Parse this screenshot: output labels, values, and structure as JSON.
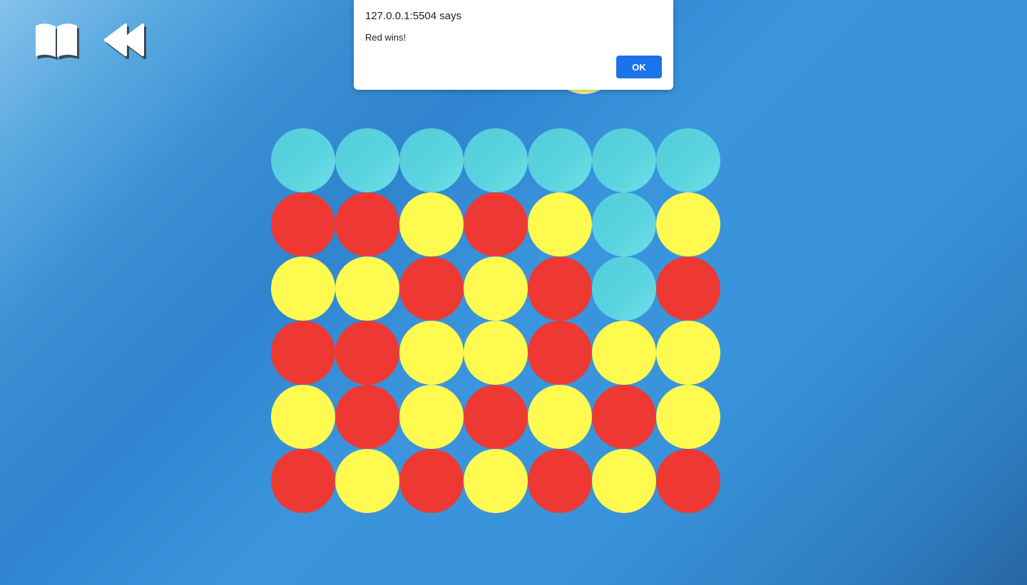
{
  "toolbar": {
    "rules_icon": "open-book-icon",
    "rewind_icon": "rewind-icon"
  },
  "dialog": {
    "title": "127.0.0.1:5504 says",
    "message": "Red wins!",
    "ok_label": "OK"
  },
  "game": {
    "dropping_piece": "yellow",
    "columns": 7,
    "rows": 6,
    "board": [
      [
        "empty",
        "empty",
        "empty",
        "empty",
        "empty",
        "empty",
        "empty"
      ],
      [
        "red",
        "red",
        "yellow",
        "red",
        "yellow",
        "empty",
        "yellow"
      ],
      [
        "yellow",
        "yellow",
        "red",
        "yellow",
        "red",
        "empty",
        "red"
      ],
      [
        "red",
        "red",
        "yellow",
        "yellow",
        "red",
        "yellow",
        "yellow"
      ],
      [
        "yellow",
        "red",
        "yellow",
        "red",
        "yellow",
        "red",
        "yellow"
      ],
      [
        "red",
        "yellow",
        "red",
        "yellow",
        "red",
        "yellow",
        "red"
      ]
    ]
  },
  "colors": {
    "red": "#ee3833",
    "yellow": "#fefa50",
    "empty": "#58d3df",
    "ok_button": "#1a73e8"
  }
}
